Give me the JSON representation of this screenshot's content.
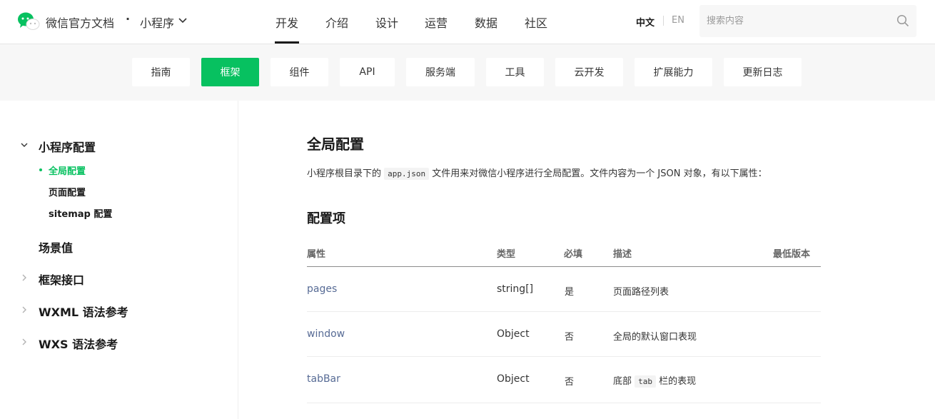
{
  "header": {
    "site_title": "微信官方文档",
    "dot": "·",
    "product": "小程序",
    "nav": [
      "开发",
      "介绍",
      "设计",
      "运营",
      "数据",
      "社区"
    ],
    "lang_zh": "中文",
    "lang_en": "EN",
    "search_placeholder": "搜索内容"
  },
  "subnav": {
    "items": [
      "指南",
      "框架",
      "组件",
      "API",
      "服务端",
      "工具",
      "云开发",
      "扩展能力",
      "更新日志"
    ],
    "active": "框架"
  },
  "sidebar": {
    "section1": "小程序配置",
    "sub1": "全局配置",
    "sub2": "页面配置",
    "sub3": "sitemap 配置",
    "section2": "场景值",
    "section3": "框架接口",
    "section4": "WXML 语法参考",
    "section5": "WXS 语法参考"
  },
  "main": {
    "title": "全局配置",
    "intro_before": "小程序根目录下的 ",
    "intro_code": "app.json",
    "intro_after": " 文件用来对微信小程序进行全局配置。文件内容为一个 JSON 对象，有以下属性：",
    "subtitle": "配置项",
    "columns": [
      "属性",
      "类型",
      "必填",
      "描述",
      "最低版本"
    ],
    "rows": [
      {
        "attr": "pages",
        "type": "string[]",
        "required": "是",
        "desc": "页面路径列表"
      },
      {
        "attr": "window",
        "type": "Object",
        "required": "否",
        "desc": "全局的默认窗口表现"
      },
      {
        "attr": "tabBar",
        "type": "Object",
        "required": "否",
        "desc_before": "底部 ",
        "desc_code": "tab",
        "desc_after": " 栏的表现"
      }
    ]
  },
  "colors": {
    "accent": "#07c160",
    "link": "#576b95",
    "text": "#353535",
    "subnav_bg": "#f7f7f7"
  },
  "icons": {
    "logo": "wechat-logo",
    "chevron": "chevron-down-icon",
    "search": "search-icon"
  }
}
